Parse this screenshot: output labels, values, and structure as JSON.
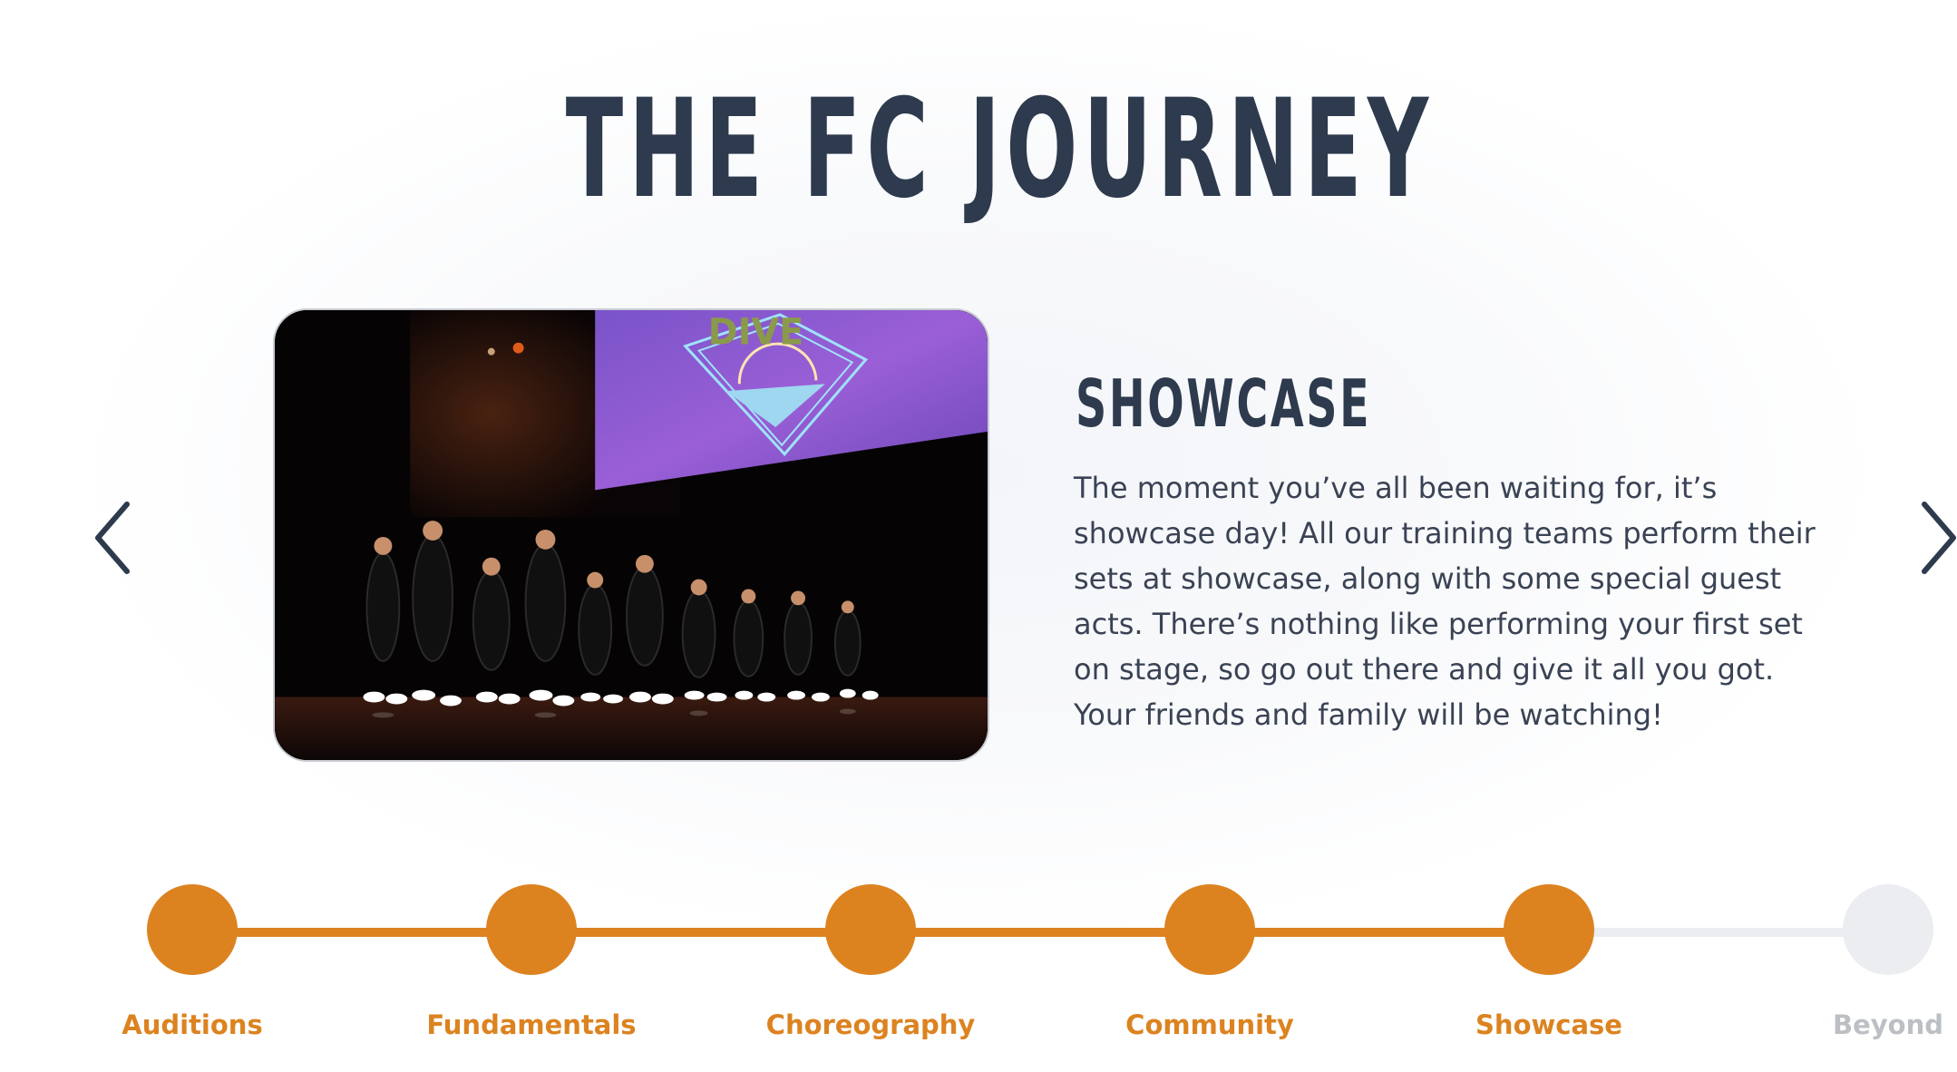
{
  "page_title": "THE FC JOURNEY",
  "colors": {
    "accent": "#dc8320",
    "heading": "#2e3a4d",
    "body_text": "#3a4354",
    "inactive": "#ebedf0",
    "inactive_label": "#bcbfc4"
  },
  "carousel": {
    "prev_icon": "chevron-left-icon",
    "next_icon": "chevron-right-icon",
    "slide": {
      "image_alt": "Dance team performing on stage at showcase",
      "heading": "SHOWCASE",
      "body": "The moment you’ve all been waiting for, it’s showcase day! All our training teams perform their sets at showcase, along with some special guest acts. There’s nothing like performing your first set on stage, so go out there and give it all you got. Your friends and family will be watching!"
    }
  },
  "timeline": {
    "steps": [
      {
        "label": "Auditions",
        "state": "done"
      },
      {
        "label": "Fundamentals",
        "state": "done"
      },
      {
        "label": "Choreography",
        "state": "done"
      },
      {
        "label": "Community",
        "state": "done"
      },
      {
        "label": "Showcase",
        "state": "current"
      },
      {
        "label": "Beyond",
        "state": "todo"
      }
    ]
  }
}
